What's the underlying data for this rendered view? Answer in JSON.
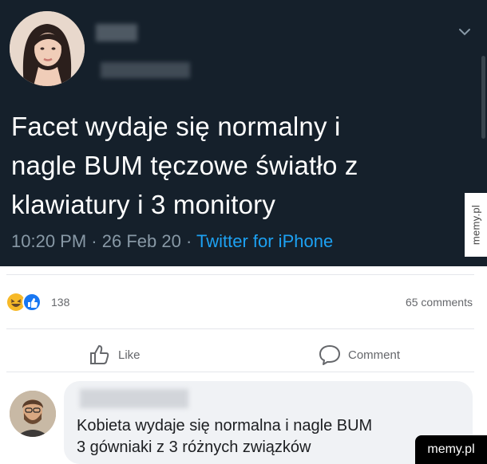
{
  "tweet": {
    "text_lines": [
      "Facet wydaje się normalny i",
      "nagle BUM tęczowe światło z",
      "klawiatury i 3 monitory"
    ],
    "time": "10:20 PM",
    "date": "26 Feb 20",
    "source": "Twitter for iPhone",
    "separator": "·",
    "background": "#15202b",
    "link_color": "#1da1f2"
  },
  "post": {
    "reaction_icons": [
      "laugh-reaction-icon",
      "like-reaction-icon"
    ],
    "reaction_count": "138",
    "comments_count": "65 comments",
    "actions": {
      "like": "Like",
      "comment": "Comment"
    }
  },
  "comment": {
    "text_lines": [
      "Kobieta wydaje się normalna i nagle BUM",
      "3 gówniaki z 3 różnych związków"
    ]
  },
  "watermarks": {
    "side": "memy.pl",
    "corner": "memy.pl"
  }
}
